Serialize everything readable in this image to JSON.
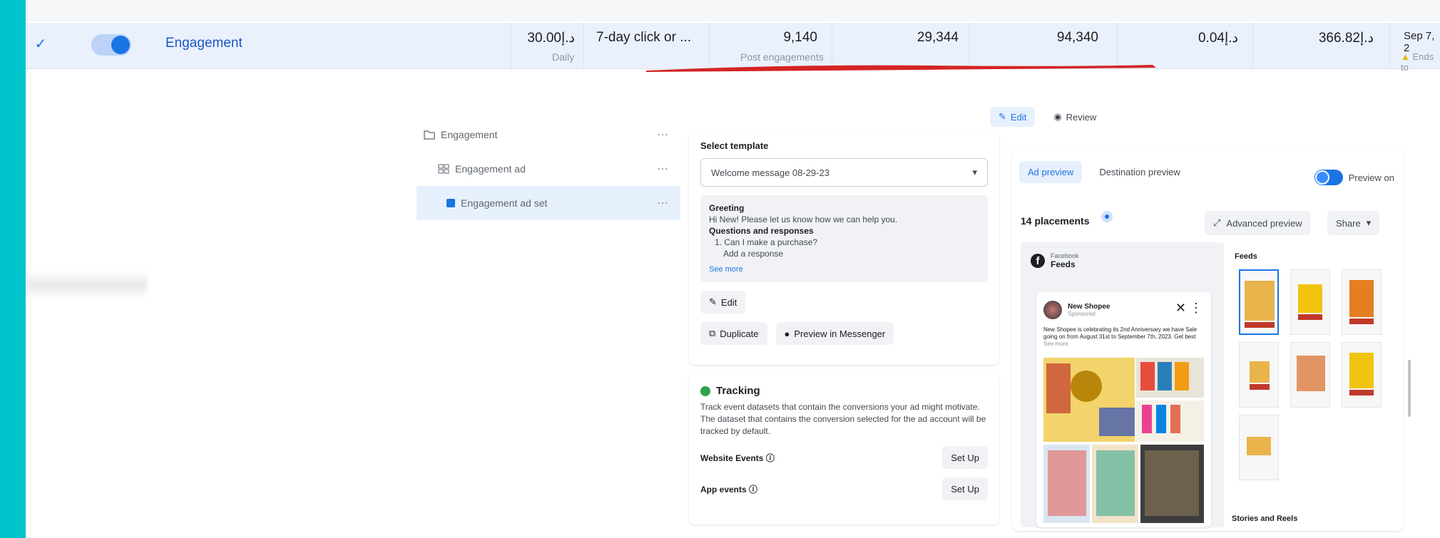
{
  "table_row": {
    "name": "Engagement",
    "budget": "30.00د.إ",
    "budget_sub": "Daily",
    "attribution": "7-day click or ...",
    "results": "9,140",
    "results_sub": "Post engagements",
    "reach": "29,344",
    "impressions": "94,340",
    "cost_per_result": "0.04د.إ",
    "amount_spent": "366.82د.إ",
    "ends": "Sep 7, 2",
    "ends_sub": "Ends to"
  },
  "tree": {
    "items": [
      {
        "label": "Engagement",
        "more": "⋯"
      },
      {
        "label": "Engagement ad",
        "more": "⋯"
      },
      {
        "label": "Engagement ad set",
        "more": "⋯"
      }
    ]
  },
  "mode": {
    "edit": "Edit",
    "review": "Review"
  },
  "template": {
    "label": "Select template",
    "selected": "Welcome message 08-29-23",
    "greeting_title": "Greeting",
    "greeting_text": "Hi New! Please let us know how we can help you.",
    "qr_title": "Questions and responses",
    "q1": "1. Can I make a purchase?",
    "add_response": "Add a response",
    "see_more": "See more",
    "edit_btn": "Edit",
    "duplicate_btn": "Duplicate",
    "preview_btn": "Preview in Messenger"
  },
  "tracking": {
    "title": "Tracking",
    "text": "Track event datasets that contain the conversions your ad might motivate. The dataset that contains the conversion selected for the ad account will be tracked by default.",
    "website_events": "Website Events",
    "app_events": "App events",
    "setup": "Set Up"
  },
  "preview": {
    "tab_ad": "Ad preview",
    "tab_dest": "Destination preview",
    "toggle_label": "Preview on",
    "placements": "14 placements",
    "advanced": "Advanced preview",
    "share": "Share",
    "platform": "Facebook",
    "placement": "Feeds",
    "feeds_label": "Feeds",
    "stories_label": "Stories and Reels",
    "post_name": "New Shopee",
    "post_sub": "Sponsored",
    "post_text": "New Shopee is celebrating its 2nd Anniversary we have Sale going on from August 31st to September 7th, 2023. Get best",
    "post_more": "See more"
  },
  "colors": {
    "accent": "#1b74e4",
    "selected_row": "#eaf1fd",
    "frame": "#00c4cc",
    "annotation": "#d42424"
  }
}
